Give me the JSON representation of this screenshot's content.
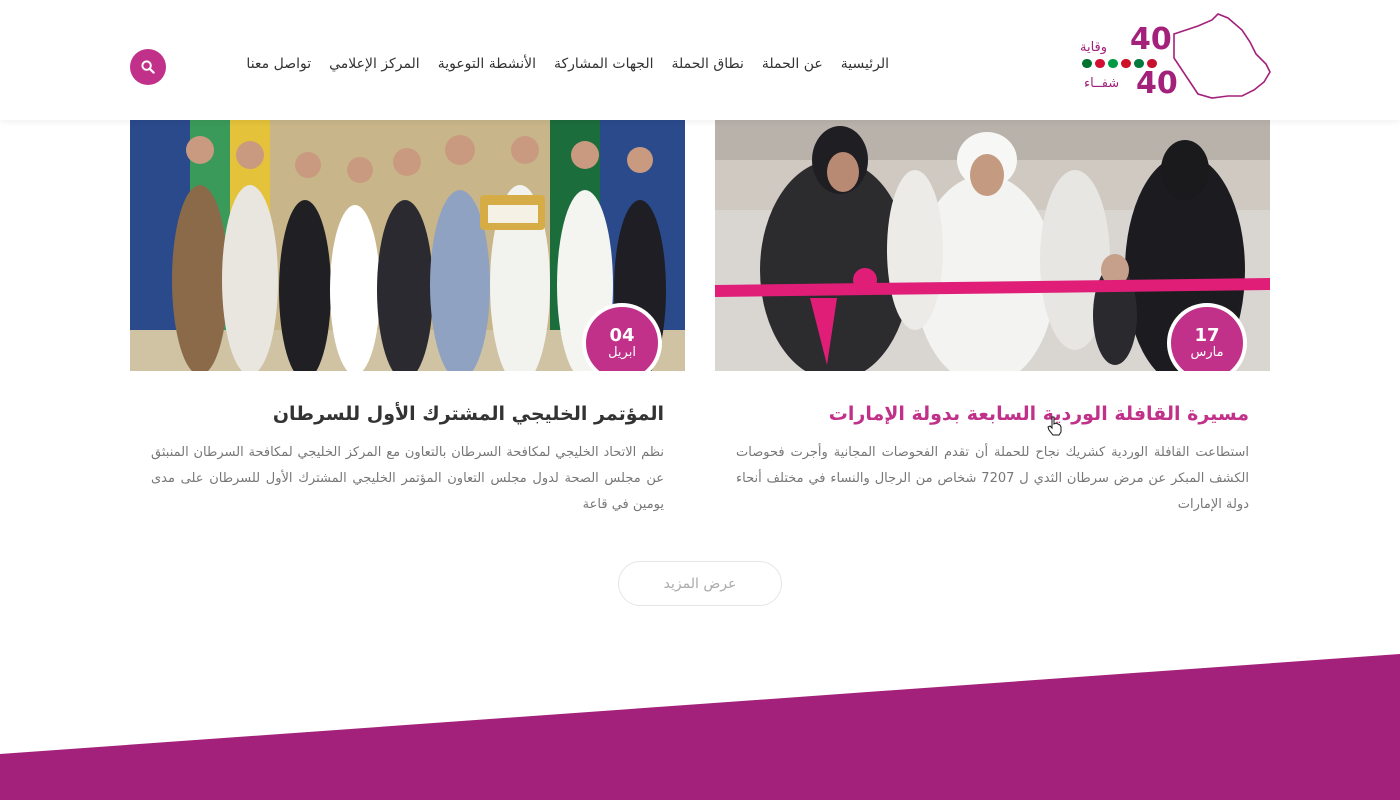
{
  "brand": {
    "logo_digits": "40",
    "logo_word_top": "وقاية",
    "logo_word_bottom": "شفــاء",
    "logo_flag_colors": [
      "#c8102e",
      "#007a3d",
      "#ce1126",
      "#009a44",
      "#d21034",
      "#00732f"
    ]
  },
  "nav": {
    "items": [
      "الرئيسية",
      "عن الحملة",
      "نطاق الحملة",
      "الجهات المشاركة",
      "الأنشطة التوعوية",
      "المركز الإعلامي",
      "تواصل معنا"
    ]
  },
  "search": {
    "icon": "search-icon"
  },
  "posts": [
    {
      "day": "17",
      "month": "مارس",
      "title": "مسيرة القافلة الوردية السابعة بدولة الإمارات",
      "excerpt": "استطاعت القافلة الوردية كشريك نجاح للحملة أن تقدم الفحوصات المجانية وأجرت فحوصات الكشف المبكر عن مرض سرطان الثدي ل 7207 شخاص من الرجال والنساء في مختلف أنحاء دولة الإمارات"
    },
    {
      "day": "04",
      "month": "ابريل",
      "title": "المؤتمر الخليجي المشترك الأول للسرطان",
      "excerpt": "نظم الاتحاد الخليجي لمكافحة السرطان بالتعاون مع المركز الخليجي لمكافحة السرطان المنبثق عن مجلس الصحة لدول مجلس التعاون المؤتمر الخليجي المشترك الأول للسرطان على مدى يومين في قاعة"
    }
  ],
  "more": {
    "label": "عرض المزيد"
  },
  "colors": {
    "accent": "#c1318a",
    "band": "#a3217a"
  }
}
